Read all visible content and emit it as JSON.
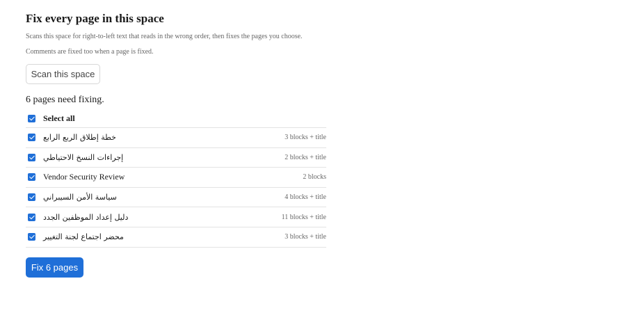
{
  "header": {
    "title": "Fix every page in this space",
    "description_1": "Scans this space for right-to-left text that reads in the wrong order, then fixes the pages you choose.",
    "description_2": "Comments are fixed too when a page is fixed."
  },
  "scan_button": {
    "label": "Scan this space"
  },
  "results": {
    "count_text": "6 pages need fixing.",
    "select_all_label": "Select all",
    "select_all_checked": true,
    "pages": [
      {
        "title": "خطة إطلاق الربع الرابع",
        "meta": "3 blocks + title",
        "checked": true,
        "rtl": true
      },
      {
        "title": "إجراءات النسخ الاحتياطي",
        "meta": "2 blocks + title",
        "checked": true,
        "rtl": true
      },
      {
        "title": "Vendor Security Review",
        "meta": "2 blocks",
        "checked": true,
        "rtl": false
      },
      {
        "title": "سياسة الأمن السيبراني",
        "meta": "4 blocks + title",
        "checked": true,
        "rtl": true
      },
      {
        "title": "دليل إعداد الموظفين الجدد",
        "meta": "11 blocks + title",
        "checked": true,
        "rtl": true
      },
      {
        "title": "محضر اجتماع لجنة التغيير",
        "meta": "3 blocks + title",
        "checked": true,
        "rtl": true
      }
    ]
  },
  "fix_button": {
    "label": "Fix 6 pages"
  },
  "colors": {
    "accent": "#1f6fd8",
    "divider": "#e3e3e3",
    "muted_text": "#666666"
  }
}
